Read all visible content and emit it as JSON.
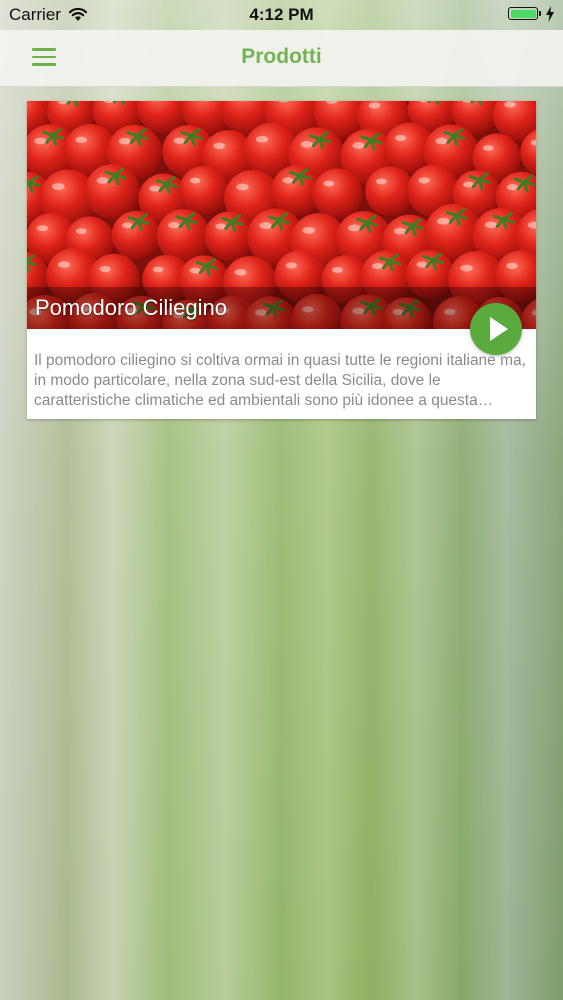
{
  "status_bar": {
    "carrier": "Carrier",
    "time": "4:12 PM",
    "icons": [
      "wifi-icon",
      "battery-icon",
      "charging-icon"
    ],
    "battery_color": "#4cd964"
  },
  "nav": {
    "title": "Prodotti",
    "menu_icon": "hamburger-menu-icon",
    "accent_color": "#74b354"
  },
  "products": [
    {
      "title": "Pomodoro Ciliegino",
      "image": "cherry-tomatoes-photo",
      "description": "Il pomodoro ciliegino si coltiva ormai in quasi tutte le regioni italiane ma, in modo particolare, nella zona sud-est della Sicilia, dove le caratteristiche climatiche ed ambientali sono più idonee a questa produzione.",
      "action_icon": "play-icon",
      "action_color": "#5aaa3d"
    }
  ]
}
